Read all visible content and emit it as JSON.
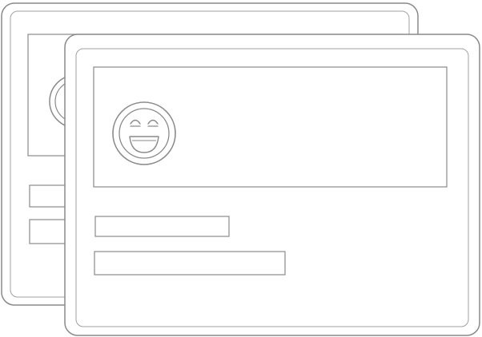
{
  "illustration": {
    "icon": "laughing-face-icon",
    "colors": {
      "background": "#ffffff",
      "card_fill": "#ffffff",
      "outline": "#8a8a8a",
      "inner_outline": "#a0a0a0",
      "face_fill": "#ffffff"
    },
    "cards": [
      {
        "role": "back-card"
      },
      {
        "role": "front-card"
      }
    ]
  }
}
